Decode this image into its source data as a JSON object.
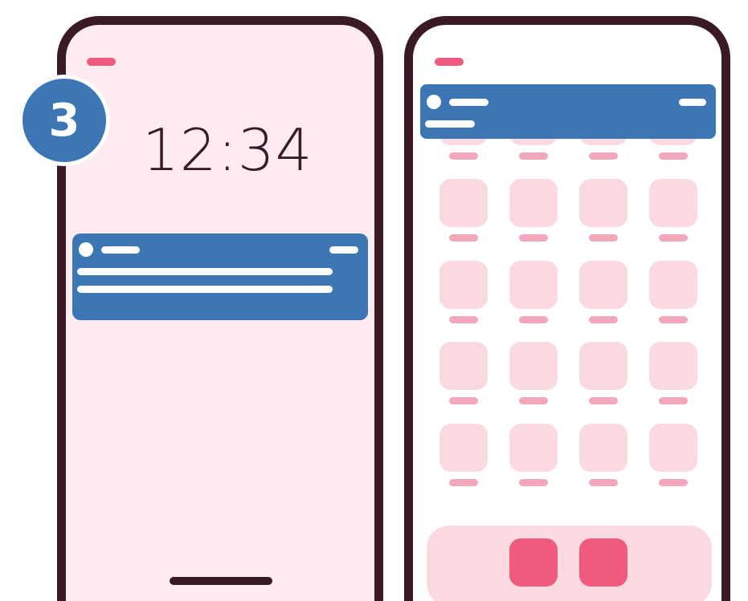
{
  "lock_screen": {
    "time": "12:34",
    "notification": {
      "app_icon": "circle-icon"
    }
  },
  "home_screen": {
    "notification": {
      "app_icon": "circle-icon"
    },
    "grid": {
      "rows": 5,
      "columns": 4,
      "first_row_partially_covered": true
    },
    "dock": {
      "app_count": 2
    }
  },
  "step_badge": {
    "label": "3"
  },
  "colors": {
    "phone_frame": "#3a1a24",
    "lock_background": "#fdebef",
    "home_background": "#ffffff",
    "notification": "#3d76b4",
    "app_icon": "#fbd9e0",
    "app_label": "#f2a7ba",
    "accent": "#ef5a7e"
  }
}
